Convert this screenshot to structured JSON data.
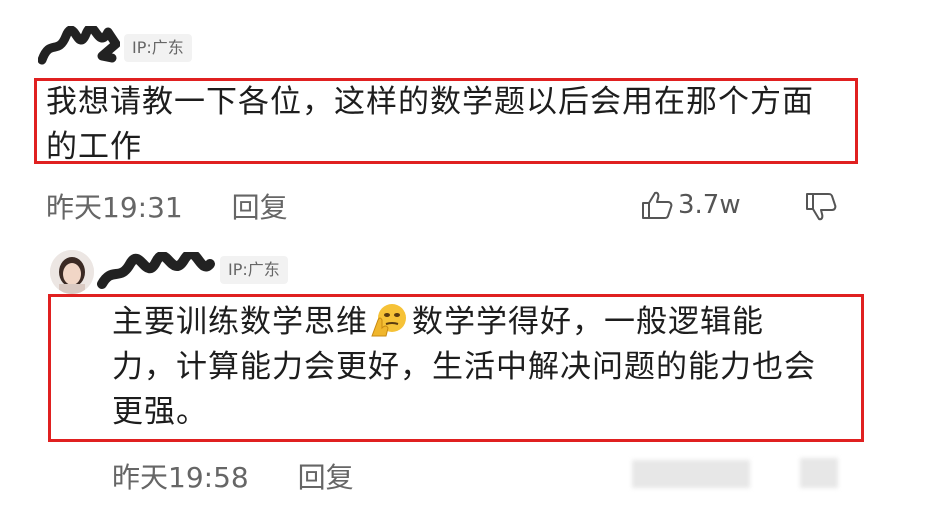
{
  "comments": [
    {
      "ip": "IP:广东",
      "text": "我想请教一下各位，这样的数学题以后会用在那个方面的工作",
      "time": "昨天19:31",
      "reply_label": "回复",
      "likes": "3.7w",
      "thumbs_up_icon": "thumbs-up-icon",
      "thumbs_down_icon": "thumbs-down-icon"
    },
    {
      "ip": "IP:广东",
      "text_before_emoji": "主要训练数学思维",
      "emoji": "thinking-face-emoji",
      "text_after_emoji": "数学学得好，一般逻辑能力，计算能力会更好，生活中解决问题的能力也会更强。",
      "time": "昨天19:58",
      "reply_label": "回复"
    }
  ],
  "colors": {
    "highlight_border": "#e02020",
    "ip_tag_bg": "#f2f2f2",
    "meta_text": "#666666"
  }
}
